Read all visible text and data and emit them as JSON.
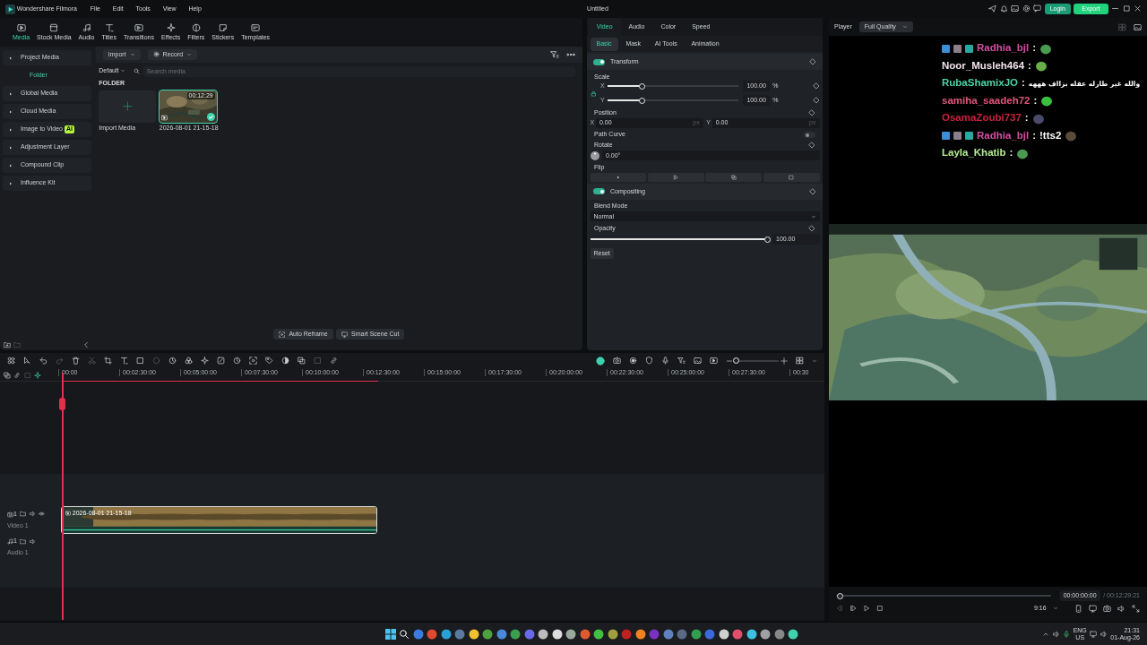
{
  "title_bar": {
    "app_name": "Wondershare Filmora",
    "menus": [
      "File",
      "Edit",
      "Tools",
      "View",
      "Help"
    ],
    "project_title": "Untitled",
    "login": "Login",
    "export": "Export"
  },
  "media_tabs": [
    {
      "label": "Media",
      "selected": true
    },
    {
      "label": "Stock Media",
      "selected": false
    },
    {
      "label": "Audio",
      "selected": false
    },
    {
      "label": "Titles",
      "selected": false
    },
    {
      "label": "Transitions",
      "selected": false
    },
    {
      "label": "Effects",
      "selected": false
    },
    {
      "label": "Filters",
      "selected": false
    },
    {
      "label": "Stickers",
      "selected": false
    },
    {
      "label": "Templates",
      "selected": false
    }
  ],
  "sidebar": {
    "items": [
      {
        "label": "Project Media",
        "selected": false,
        "children": [
          {
            "label": "Folder",
            "selected": true
          }
        ]
      },
      {
        "label": "Global Media",
        "selected": false
      },
      {
        "label": "Cloud Media",
        "selected": false
      },
      {
        "label": "Image to Video",
        "selected": false,
        "badge": "AI"
      },
      {
        "label": "Adjustment Layer",
        "selected": false
      },
      {
        "label": "Compound Clip",
        "selected": false
      },
      {
        "label": "Influence Kit",
        "selected": false
      }
    ]
  },
  "media_toolbar": {
    "import": "Import",
    "record": "Record",
    "sort": "Default",
    "search_placeholder": "Search media"
  },
  "media_bin": {
    "section": "FOLDER",
    "items": [
      {
        "kind": "import",
        "label": "Import Media"
      },
      {
        "kind": "clip",
        "label": "2026-08-01 21-15-18",
        "duration": "00:12:29",
        "selected": true
      }
    ]
  },
  "media_footer": [
    "Auto Reframe",
    "Smart Scene Cut"
  ],
  "properties": {
    "tabs": [
      {
        "label": "Video",
        "selected": true
      },
      {
        "label": "Audio",
        "selected": false
      },
      {
        "label": "Color",
        "selected": false
      },
      {
        "label": "Speed",
        "selected": false
      }
    ],
    "subtabs": [
      {
        "label": "Basic",
        "selected": true
      },
      {
        "label": "Mask",
        "selected": false
      },
      {
        "label": "AI Tools",
        "selected": false
      },
      {
        "label": "Animation",
        "selected": false
      }
    ],
    "transform": {
      "title": "Transform",
      "on": true,
      "scale_label": "Scale",
      "scale": [
        {
          "axis": "X",
          "level": 0.26,
          "value": "100.00",
          "unit": "%"
        },
        {
          "axis": "Y",
          "level": 0.26,
          "value": "100.00",
          "unit": "%"
        }
      ],
      "position_label": "Position",
      "position": [
        {
          "axis": "X",
          "value": "0.00",
          "unit": "px"
        },
        {
          "axis": "Y",
          "value": "0.00",
          "unit": "px"
        }
      ],
      "path_curve": {
        "label": "Path Curve",
        "on": false
      },
      "rotate_label": "Rotate",
      "rotate": "0.00°",
      "flip_label": "Flip"
    },
    "compositing": {
      "title": "Compositing",
      "on": true,
      "blend_label": "Blend Mode",
      "blend": "Normal",
      "opacity_label": "Opacity",
      "opacity": {
        "level": 0.99,
        "value": "100.00"
      }
    },
    "reset": "Reset"
  },
  "timeline": {
    "zoom": {
      "level": 0.05
    },
    "ruler": [
      "00:00",
      "00:02:30:00",
      "00:05:00:00",
      "00:07:30:00",
      "00:10:00:00",
      "00:12:30:00",
      "00:15:00:00",
      "00:17:30:00",
      "00:20:00:00",
      "00:22:30:00",
      "00:25:00:00",
      "00:27:30:00",
      "00:30"
    ],
    "tracks": [
      {
        "kind": "video",
        "number": "1",
        "label": "Video 1",
        "clip": "2026-08-01 21-15-18"
      },
      {
        "kind": "audio",
        "number": "1",
        "label": "Audio 1"
      }
    ]
  },
  "player": {
    "label": "Player",
    "quality": "Full Quality",
    "chat": [
      {
        "name": "Radhia_bjl",
        "color": "#d250a0",
        "badges": true,
        "sep": ":",
        "emote": true
      },
      {
        "name": "Noor_Musleh464",
        "color": "#f2e4ec",
        "badges": false,
        "sep": ":",
        "emote": true
      },
      {
        "name": "RubaShamixJO",
        "color": "#4cd2a4",
        "badges": false,
        "sep": ":",
        "message": "والله غير طارله عقله بزااف هههه",
        "emote": false
      },
      {
        "name": "samiha_saadeh72",
        "color": "#e0557a",
        "badges": false,
        "sep": ":",
        "emote": true
      },
      {
        "name": "OsamaZoubi737",
        "color": "#c8223f",
        "badges": false,
        "sep": ":",
        "emote": true
      },
      {
        "name": "Radhia_bjl",
        "color": "#d250a0",
        "badges": true,
        "sep": ":",
        "message": "!tts2",
        "emote": true
      },
      {
        "name": "Layla_Khatib",
        "color": "#b4ec94",
        "badges": false,
        "sep": ":",
        "emote": true
      }
    ],
    "current_time": "00:00:00:00",
    "total_time": "/ 00:12:29:21",
    "ratio": "9:16"
  },
  "taskbar": {
    "language": "ENG",
    "region": "US",
    "time": "21:31",
    "date": "01-Aug-26"
  }
}
